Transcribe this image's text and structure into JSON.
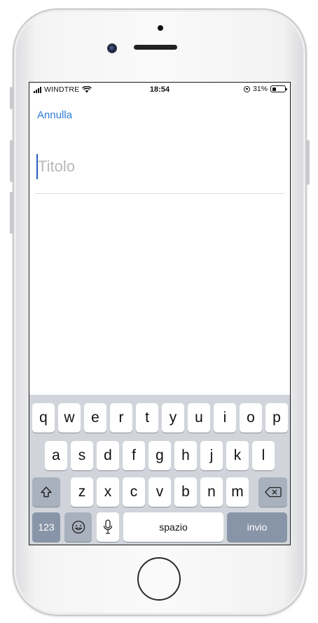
{
  "status_bar": {
    "carrier": "WINDTRE",
    "time": "18:54",
    "battery": "31%",
    "battery_level": 0.31,
    "icons": [
      "signal-icon",
      "wifi-icon",
      "orientation-lock-icon",
      "battery-icon"
    ]
  },
  "nav": {
    "cancel_label": "Annulla"
  },
  "form": {
    "title_placeholder": "Titolo"
  },
  "keyboard": {
    "row1": [
      "q",
      "w",
      "e",
      "r",
      "t",
      "y",
      "u",
      "i",
      "o",
      "p"
    ],
    "row2": [
      "a",
      "s",
      "d",
      "f",
      "g",
      "h",
      "j",
      "k",
      "l"
    ],
    "row3": [
      "z",
      "x",
      "c",
      "v",
      "b",
      "n",
      "m"
    ],
    "numbers_label": "123",
    "space_label": "spazio",
    "return_label": "invio",
    "icons": [
      "shift-icon",
      "delete-icon",
      "emoji-icon",
      "microphone-icon"
    ]
  },
  "colors": {
    "accent": "#2c7dd4",
    "keyboard_bg": "#d1d5db",
    "function_key": "#8895a8"
  }
}
